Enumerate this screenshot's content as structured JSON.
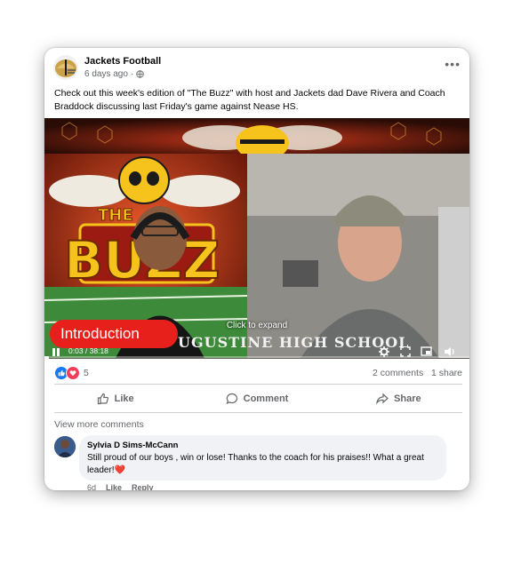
{
  "post": {
    "page_name": "Jackets Football",
    "time_ago": "6 days ago",
    "privacy_glyph": "·",
    "more_label": "•••",
    "text": "Check out this week's edition of \"The Buzz\" with host and Jackets dad Dave Rivera and Coach Braddock discussing last Friday's game against Nease HS."
  },
  "video": {
    "intro_label": "Introduction",
    "school_banner": "UGUSTINE HIGH SCHOOL",
    "click_to_expand": "Click to expand",
    "timecode": "0:03 / 38:18",
    "progress_fraction": 0.0013,
    "logo_text_top": "THE",
    "logo_text_main": "BUZZ"
  },
  "engagement": {
    "reaction_count": "5",
    "comments_label": "2 comments",
    "shares_label": "1 share"
  },
  "actions": {
    "like": "Like",
    "comment": "Comment",
    "share": "Share"
  },
  "comments": {
    "view_more": "View more comments",
    "items": [
      {
        "author": "Sylvia D Sims-McCann",
        "text": "Still proud of our boys , win or lose! Thanks to the coach for his praises!! What a great leader!",
        "heart": "❤️",
        "age": "6d",
        "like_label": "Like",
        "reply_label": "Reply"
      }
    ]
  },
  "colors": {
    "accent_red": "#e8201b",
    "like_blue": "#1877f2",
    "love_red": "#f33e58",
    "secondary_text": "#65676b"
  }
}
